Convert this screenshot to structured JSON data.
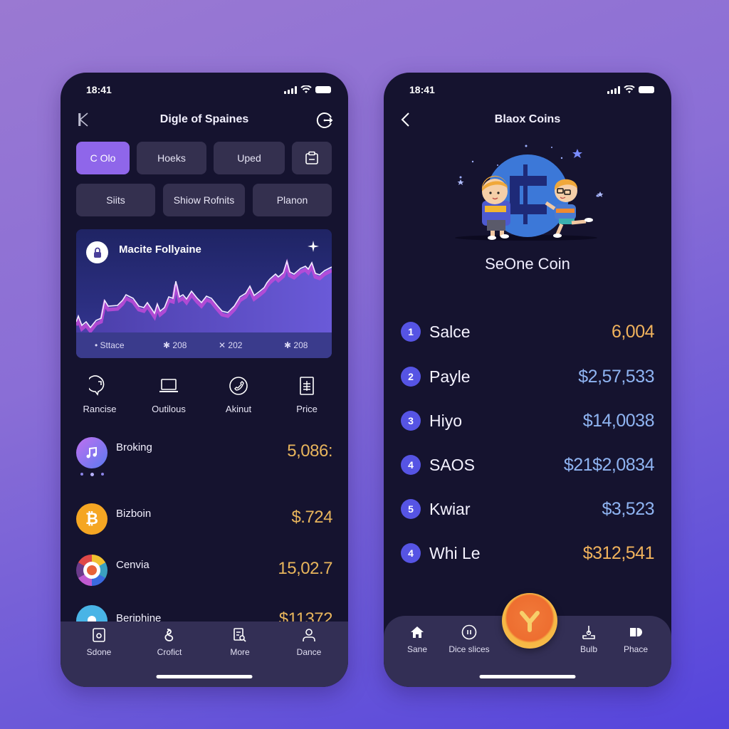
{
  "left_phone": {
    "status": {
      "time": "18:41"
    },
    "header": {
      "title": "Digle of Spaines",
      "left_icon": "k-logo-icon",
      "right_icon": "logout-circle-icon"
    },
    "chips_row1": [
      {
        "label": "C Olo",
        "active": true
      },
      {
        "label": "Hoeks",
        "active": false
      },
      {
        "label": "Uped",
        "active": false
      },
      {
        "label": "",
        "icon": "clipboard-icon",
        "active": false
      }
    ],
    "chips_row2": [
      {
        "label": "Siits"
      },
      {
        "label": "Shiow Rofnits"
      },
      {
        "label": "Planon"
      }
    ],
    "chart": {
      "title": "Macite Follyaine",
      "footer": [
        {
          "icon": "dot-icon",
          "label": "• Sttace"
        },
        {
          "icon": "sparkle-icon",
          "label": "208"
        },
        {
          "icon": "cross-icon",
          "label": "202"
        },
        {
          "icon": "sparkle-icon",
          "label": "208"
        }
      ]
    },
    "quick_actions": [
      {
        "label": "Rancise",
        "icon": "chat-bubble-icon"
      },
      {
        "label": "Outilous",
        "icon": "laptop-icon"
      },
      {
        "label": "Akinut",
        "icon": "phone-circle-icon"
      },
      {
        "label": "Price",
        "icon": "document-list-icon"
      }
    ],
    "assets": [
      {
        "name": "Broking",
        "value": "5,086:",
        "icon": "music-note-icon",
        "color": "#8a6ff0"
      },
      {
        "name": "Bizboin",
        "value": "$.724",
        "icon": "bitcoin-icon",
        "color": "#f5a623"
      },
      {
        "name": "Cenvia",
        "value": "15,02.7",
        "icon": "colorful-ring-icon",
        "color": "#e04848"
      },
      {
        "name": "Beriphine",
        "value": "$11372",
        "icon": "ghost-icon",
        "color": "#49b4e6"
      }
    ],
    "tabbar": [
      {
        "label": "Sdone",
        "icon": "square-o-icon"
      },
      {
        "label": "Crofict",
        "icon": "swirl-icon"
      },
      {
        "label": "More",
        "icon": "doc-search-icon"
      },
      {
        "label": "Dance",
        "icon": "person-icon"
      }
    ]
  },
  "right_phone": {
    "status": {
      "time": "18:41"
    },
    "header": {
      "title": "Blaox Coins",
      "back_icon": "chevron-left-icon"
    },
    "coin_name": "SeOne Coin",
    "rankings": [
      {
        "rank": "1",
        "name": "Salce",
        "value": "6,004",
        "color": "#f0b25c"
      },
      {
        "rank": "2",
        "name": "Payle",
        "value": "$2,57,533",
        "color": "#8fb4f2"
      },
      {
        "rank": "3",
        "name": "Hiyo",
        "value": "$14,0038",
        "color": "#8fb4f2"
      },
      {
        "rank": "4",
        "name": "SAOS",
        "value": "$21$2,0834",
        "color": "#8fb4f2"
      },
      {
        "rank": "5",
        "name": "Kwiar",
        "value": "$3,523",
        "color": "#8fb4f2"
      },
      {
        "rank": "4",
        "name": "Whi Le",
        "value": "$312,541",
        "color": "#f0b25c"
      }
    ],
    "tabbar": [
      {
        "label": "Sane",
        "icon": "home-icon"
      },
      {
        "label": "Dice slices",
        "icon": "music-circle-icon"
      },
      {
        "label": "Bulb",
        "icon": "joystick-icon"
      },
      {
        "label": "Phace",
        "icon": "tag-icon"
      }
    ],
    "fab_icon": "y-logo-icon"
  },
  "colors": {
    "accent": "#8f66ea",
    "phone_bg": "#15132f",
    "gold": "#e8b55c",
    "blue_value": "#8fb4f2",
    "rank_badge": "#5654e4"
  }
}
